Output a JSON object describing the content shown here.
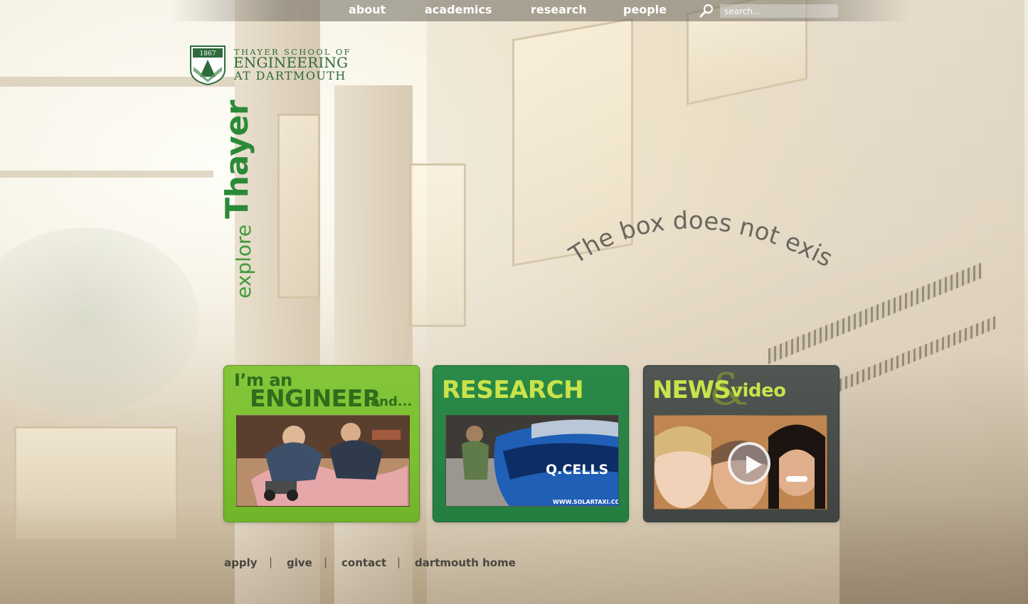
{
  "nav": {
    "items": [
      {
        "label": "about"
      },
      {
        "label": "academics"
      },
      {
        "label": "research"
      },
      {
        "label": "people"
      }
    ],
    "search": {
      "placeholder": "search..."
    }
  },
  "logo": {
    "year": "1867",
    "line1": "THAYER SCHOOL OF",
    "line2": "ENGINEERING",
    "line3": "AT DARTMOUTH"
  },
  "hero": {
    "explore": "explore",
    "thayer": "Thayer",
    "tagline": "The box does not exist."
  },
  "boxes": {
    "engineer": {
      "line1": "I’m an",
      "line2": "ENGINEER",
      "line3": "and..."
    },
    "research": {
      "title": "RESEARCH",
      "photo_text": "Q.CELLS",
      "photo_caption": "WWW.SOLARTAXI.COM"
    },
    "news": {
      "title": "NEWS",
      "amp": "&",
      "sub": "video"
    }
  },
  "footer": {
    "links": [
      {
        "label": "apply"
      },
      {
        "label": "give"
      },
      {
        "label": "contact"
      },
      {
        "label": "dartmouth home"
      }
    ],
    "separator": "|"
  },
  "colors": {
    "brand_green": "#2f6a3d",
    "engineer_box": "#7bc030",
    "research_box": "#247f40",
    "news_box": "#3f4542",
    "headline_lime": "#c9e34a"
  }
}
